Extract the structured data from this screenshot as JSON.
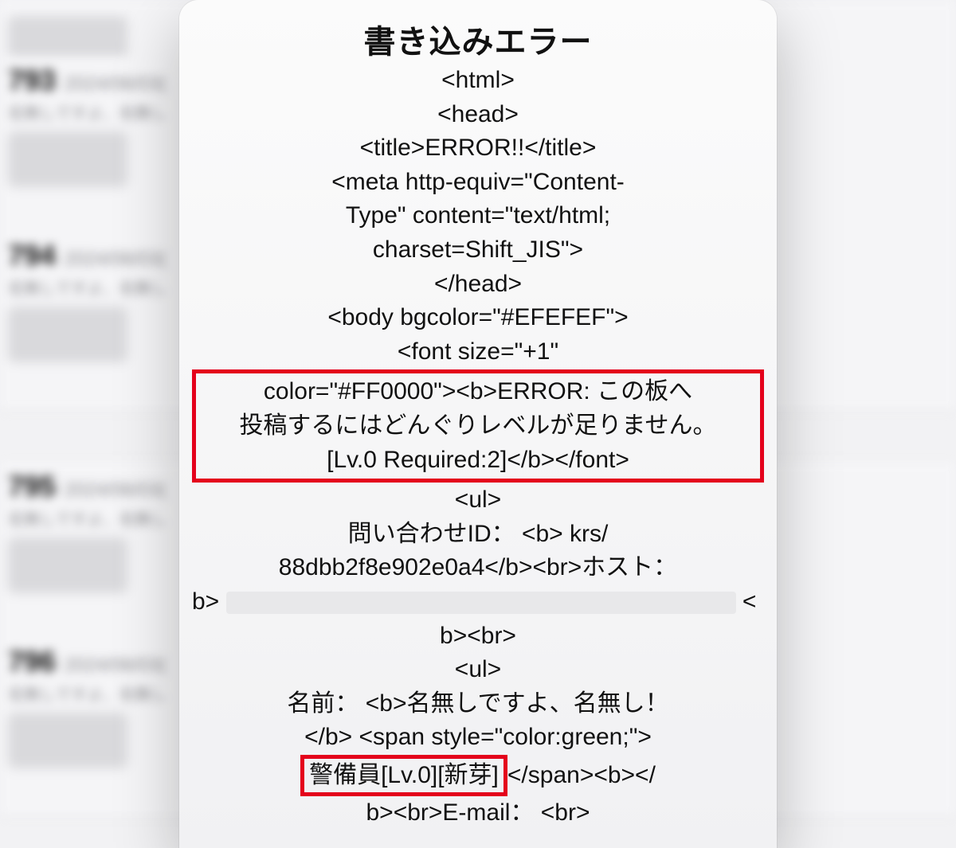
{
  "bg": {
    "posts": [
      {
        "num": "793",
        "date": "2024/06/03(",
        "name": "名無しですよ、名無し"
      },
      {
        "num": "794",
        "date": "2024/06/03(",
        "name": "名無しですよ、名無し"
      },
      {
        "num": "795",
        "date": "2024/06/03(",
        "name": "名無しですよ、名無し"
      },
      {
        "num": "796",
        "date": "2024/06/03(",
        "name": "名無しですよ、名無し"
      }
    ]
  },
  "modal": {
    "title": "書き込みエラー",
    "lines": {
      "l1": "<html>",
      "l2": "<head>",
      "l3": "<title>ERROR!!</title>",
      "l4a": "<meta http-equiv=\"Content-",
      "l4b": "Type\" content=\"text/html;",
      "l4c": "charset=Shift_JIS\">",
      "l5": "</head>",
      "l6": "<body bgcolor=\"#EFEFEF\">",
      "l7": "<font size=\"+1\"",
      "hl1a": "color=\"#FF0000\"><b>ERROR: この板へ",
      "hl1b": "投稿するにはどんぐりレベルが足りません。",
      "hl1c": "[Lv.0 Required:2]</b></font>",
      "l8": "<ul>",
      "l9a": "問い合わせID： <b> krs/",
      "l9b": "88dbb2f8e902e0a4</b><br>ホスト：",
      "l10pre": "b>",
      "l10post": "<",
      "l11": "b><br>",
      "l12": "<ul>",
      "l13a": "名前： <b>名無しですよ、名無し！",
      "l13b": "</b> <span style=\"color:green;\">",
      "hl2": "警備員[Lv.0][新芽]",
      "l14tail": "</span><b></",
      "l15": "b><br>E-mail： <br>"
    }
  }
}
